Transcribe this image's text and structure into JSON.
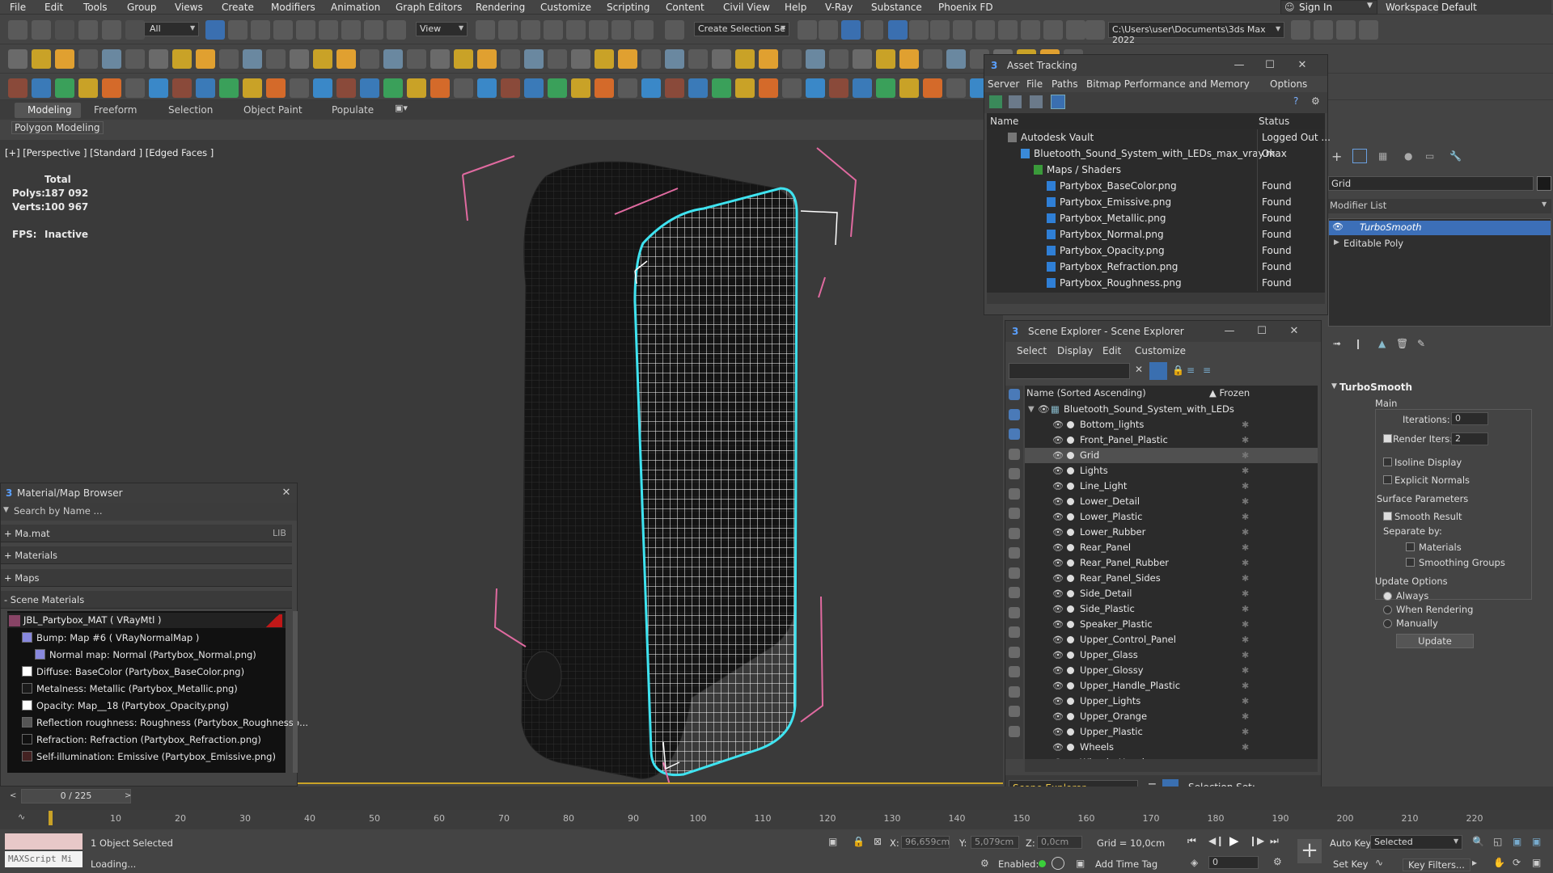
{
  "menubar": {
    "items": [
      "File",
      "Edit",
      "Tools",
      "Group",
      "Views",
      "Create",
      "Modifiers",
      "Animation",
      "Graph Editors",
      "Rendering",
      "Customize",
      "Scripting",
      "Content",
      "Civil View",
      "Help",
      "V-Ray",
      "Substance",
      "Phoenix FD"
    ],
    "sign_in": "Sign In",
    "workspaces_label": "Workspaces:",
    "workspace_value": "Default"
  },
  "toolbar": {
    "filter_value": "All",
    "ref_coord": "View",
    "selection_set": "Create Selection Se",
    "project_path": "C:\\Users\\user\\Documents\\3ds Max 2022"
  },
  "ribbon": {
    "tabs": [
      "Modeling",
      "Freeform",
      "Selection",
      "Object Paint",
      "Populate"
    ],
    "sub_label": "Polygon Modeling"
  },
  "viewport": {
    "label": "[+] [Perspective ] [Standard ] [Edged Faces ]",
    "total_label": "Total",
    "polys_label": "Polys:",
    "polys_value": "187 092",
    "verts_label": "Verts:",
    "verts_value": "100 967",
    "fps_label": "FPS:",
    "fps_value": "Inactive"
  },
  "asset_tracking": {
    "title": "Asset Tracking",
    "menu": [
      "Server",
      "File",
      "Paths",
      "Bitmap Performance and Memory",
      "Options"
    ],
    "col_name": "Name",
    "col_status": "Status",
    "rows": [
      {
        "name": "Autodesk Vault",
        "status": "Logged Out ..."
      },
      {
        "name": "Bluetooth_Sound_System_with_LEDs_max_vray.max",
        "status": "Ok"
      },
      {
        "name": "Maps / Shaders",
        "status": ""
      },
      {
        "name": "Partybox_BaseColor.png",
        "status": "Found"
      },
      {
        "name": "Partybox_Emissive.png",
        "status": "Found"
      },
      {
        "name": "Partybox_Metallic.png",
        "status": "Found"
      },
      {
        "name": "Partybox_Normal.png",
        "status": "Found"
      },
      {
        "name": "Partybox_Opacity.png",
        "status": "Found"
      },
      {
        "name": "Partybox_Refraction.png",
        "status": "Found"
      },
      {
        "name": "Partybox_Roughness.png",
        "status": "Found"
      }
    ]
  },
  "scene_explorer": {
    "title": "Scene Explorer - Scene Explorer",
    "menu": [
      "Select",
      "Display",
      "Edit",
      "Customize"
    ],
    "col_name": "Name (Sorted Ascending)",
    "col_frozen": "▲ Frozen",
    "root": "Bluetooth_Sound_System_with_LEDs",
    "items": [
      "Bottom_lights",
      "Front_Panel_Plastic",
      "Grid",
      "Lights",
      "Line_Light",
      "Lower_Detail",
      "Lower_Plastic",
      "Lower_Rubber",
      "Rear_Panel",
      "Rear_Panel_Rubber",
      "Rear_Panel_Sides",
      "Side_Detail",
      "Side_Plastic",
      "Speaker_Plastic",
      "Upper_Control_Panel",
      "Upper_Glass",
      "Upper_Glossy",
      "Upper_Handle_Plastic",
      "Upper_Lights",
      "Upper_Orange",
      "Upper_Plastic",
      "Wheels",
      "Wheels_Housing"
    ],
    "selected_item": "Grid",
    "footer_dropdown": "Scene Explorer",
    "selection_set_label": "Selection Set:"
  },
  "material_browser": {
    "title": "Material/Map Browser",
    "search_placeholder": "Search by Name ...",
    "groups": [
      "+ Ma.mat",
      "+ Materials",
      "+ Maps",
      "- Scene Materials"
    ],
    "lib_tag": "LIB",
    "material_name": "JBL_Partybox_MAT ( VRayMtl )",
    "maps": [
      "Bump: Map #6 ( VRayNormalMap )",
      "Normal map: Normal (Partybox_Normal.png)",
      "Diffuse: BaseColor (Partybox_BaseColor.png)",
      "Metalness: Metallic (Partybox_Metallic.png)",
      "Opacity: Map__18 (Partybox_Opacity.png)",
      "Reflection roughness: Roughness (Partybox_Roughnessp...",
      "Refraction: Refraction (Partybox_Refraction.png)",
      "Self-illumination: Emissive (Partybox_Emissive.png)"
    ]
  },
  "command_panel": {
    "object_name": "Grid",
    "modifier_list": "Modifier List",
    "stack": [
      "TurboSmooth",
      "Editable Poly"
    ],
    "rollout_title": "TurboSmooth",
    "main_label": "Main",
    "iterations_label": "Iterations:",
    "iterations_value": "0",
    "render_iters_label": "Render Iters:",
    "render_iters_value": "2",
    "isoline_label": "Isoline Display",
    "explicit_normals_label": "Explicit Normals",
    "surface_params_label": "Surface Parameters",
    "smooth_result_label": "Smooth Result",
    "separate_by_label": "Separate by:",
    "materials_label": "Materials",
    "smoothing_groups_label": "Smoothing Groups",
    "update_options_label": "Update Options",
    "always_label": "Always",
    "when_rendering_label": "When Rendering",
    "manually_label": "Manually",
    "update_button": "Update"
  },
  "timeline": {
    "frame_counter": "0 / 225",
    "ticks": [
      "10",
      "20",
      "30",
      "40",
      "50",
      "60",
      "70",
      "80",
      "90",
      "100",
      "110",
      "120",
      "130",
      "140",
      "150",
      "160",
      "170",
      "180",
      "190",
      "200",
      "210",
      "220"
    ]
  },
  "statusbar": {
    "maxscript": "MAXScript Mi",
    "selected_text": "1 Object Selected",
    "loading_text": "Loading...",
    "x_label": "X:",
    "x_value": "96,659cm",
    "y_label": "Y:",
    "y_value": "5,079cm",
    "z_label": "Z:",
    "z_value": "0,0cm",
    "grid_text": "Grid = 10,0cm",
    "enabled_label": "Enabled:",
    "add_time_tag": "Add Time Tag",
    "frame_value": "0",
    "auto_key": "Auto Key",
    "set_key": "Set Key",
    "selected_dropdown": "Selected",
    "key_filters": "Key Filters..."
  }
}
